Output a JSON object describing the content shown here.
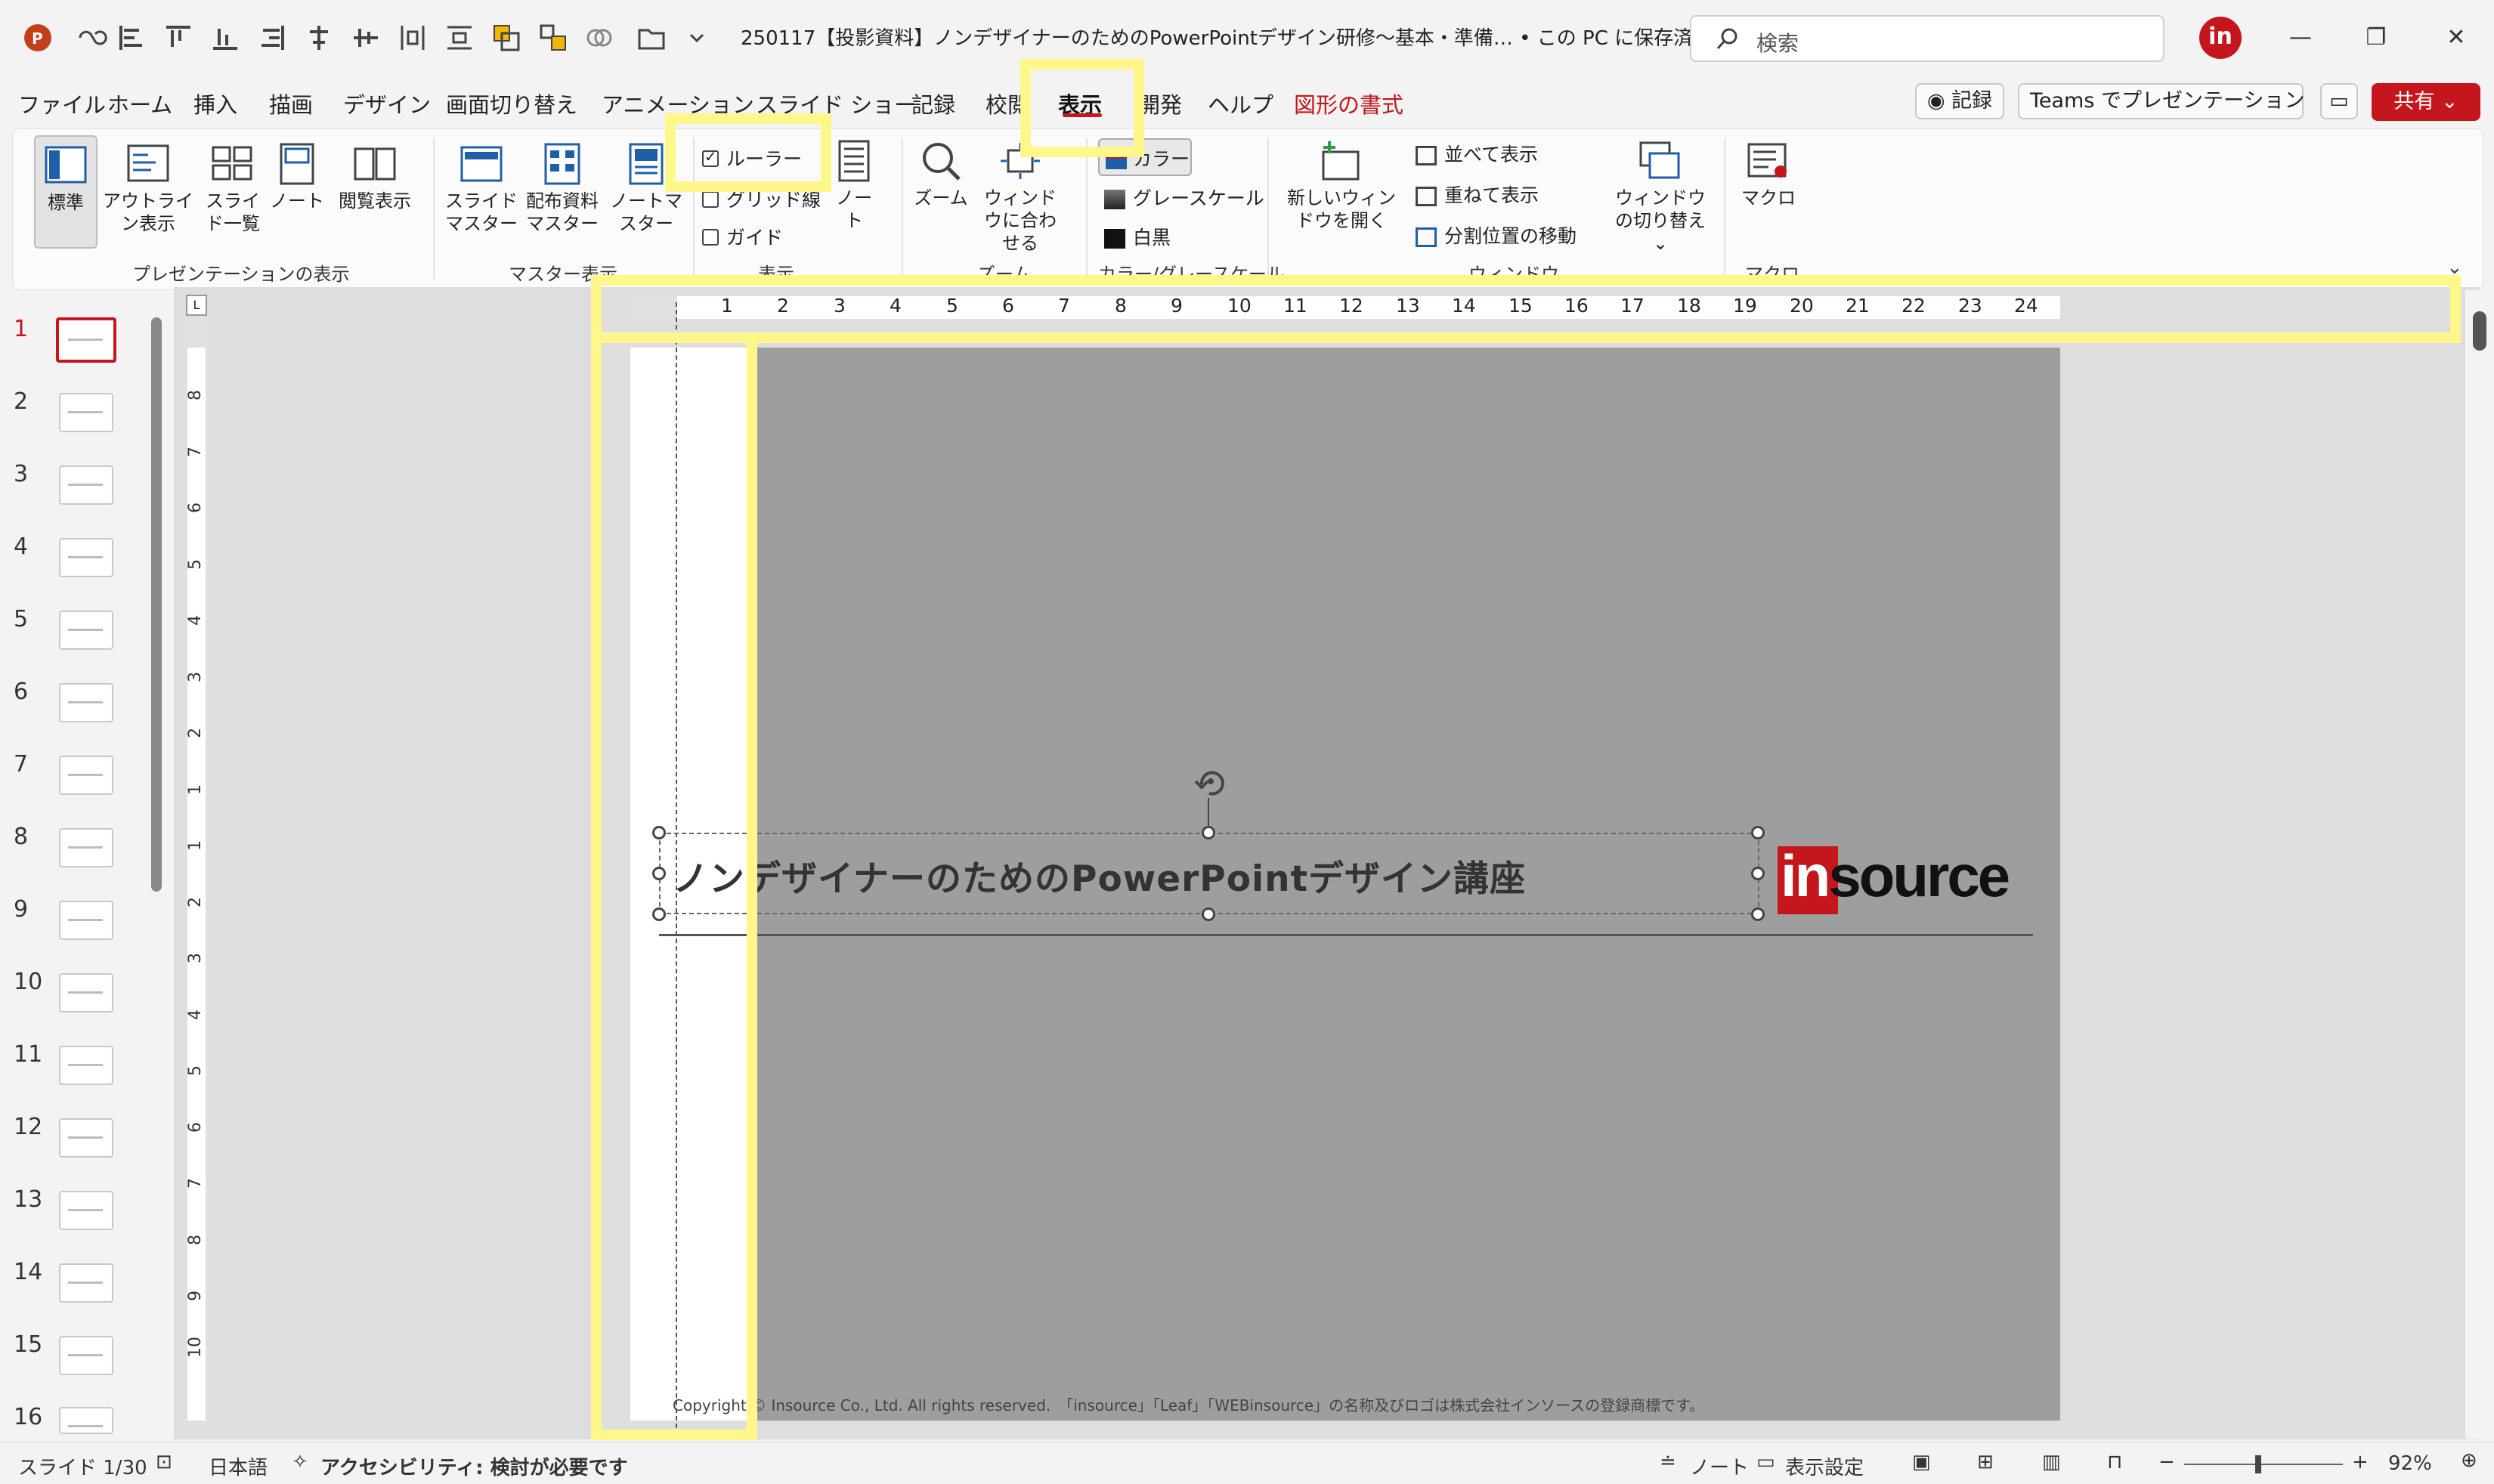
{
  "titlebar": {
    "doc_title": "250117【投影資料】ノンデザイナーのためのPowerPointデザイン研修～基本・準備… • この PC に保存済み ⌄",
    "search_placeholder": "検索",
    "avatar_letter": "in",
    "minimize": "—",
    "restore": "❐",
    "close": "✕"
  },
  "tabs": [
    "ファイル",
    "ホーム",
    "挿入",
    "描画",
    "デザイン",
    "画面切り替え",
    "アニメーション",
    "スライド ショー",
    "記録",
    "校閲",
    "表示",
    "開発",
    "ヘルプ",
    "図形の書式"
  ],
  "tab_actions": {
    "record": "◉ 記録",
    "teams": "Teams でプレゼンテーション",
    "share": "共有 ⌄"
  },
  "ribbon": {
    "presentation_views": {
      "label": "プレゼンテーションの表示",
      "normal": "標準",
      "outline": "アウトライン表示",
      "sorter": "スライド一覧",
      "notes": "ノート",
      "reading": "閲覧表示"
    },
    "master_views": {
      "label": "マスター表示",
      "slide_master": "スライドマスター",
      "handout_master": "配布資料マスター",
      "notes_master": "ノートマスター"
    },
    "show": {
      "label": "表示",
      "ruler": "ルーラー",
      "ruler_checked": true,
      "gridlines": "グリッド線",
      "guides": "ガイド",
      "notes": "ノート"
    },
    "zoom": {
      "label": "ズーム",
      "zoom": "ズーム",
      "fit": "ウィンドウに合わせる"
    },
    "color": {
      "label": "カラー/グレースケール",
      "color": "カラー",
      "grayscale": "グレースケール",
      "bw": "白黒"
    },
    "window": {
      "label": "ウィンドウ",
      "new_window": "新しいウィンドウを開く",
      "arrange": "並べて表示",
      "cascade": "重ねて表示",
      "move_split": "分割位置の移動",
      "switch": "ウィンドウの切り替え ⌄"
    },
    "macro": {
      "label": "マクロ",
      "macro": "マクロ"
    }
  },
  "ruler_top_ticks": [
    "1",
    "2",
    "3",
    "4",
    "5",
    "6",
    "7",
    "8",
    "9",
    "10",
    "11",
    "12",
    "13",
    "14",
    "15",
    "16",
    "17",
    "18",
    "19",
    "20",
    "21",
    "22",
    "23",
    "24"
  ],
  "ruler_left_ticks": [
    "8",
    "7",
    "6",
    "5",
    "4",
    "3",
    "2",
    "1",
    "1",
    "2",
    "3",
    "4",
    "5",
    "6",
    "7",
    "8",
    "9",
    "10"
  ],
  "slides": [
    "1",
    "2",
    "3",
    "4",
    "5",
    "6",
    "7",
    "8",
    "9",
    "10",
    "11",
    "12",
    "13",
    "14",
    "15",
    "16"
  ],
  "current_slide": "1",
  "slide": {
    "title": "ノンデザイナーのためのPowerPointデザイン講座",
    "logo_in": "in",
    "logo_source": "source",
    "copyright": "Copyright © Insource Co., Ltd. All rights reserved.　「insource」「Leaf」「WEBinsource」の名称及びロゴは株式会社インソースの登録商標です。"
  },
  "status": {
    "slide_count": "スライド 1/30",
    "language": "日本語",
    "accessibility": "アクセシビリティ: 検討が必要です",
    "notes": "ノート",
    "display_settings": "表示設定",
    "zoom": "92%",
    "zoom_minus": "−",
    "zoom_plus": "+"
  },
  "colors": {
    "accent": "#c4161c",
    "highlight": "#fff78a"
  }
}
